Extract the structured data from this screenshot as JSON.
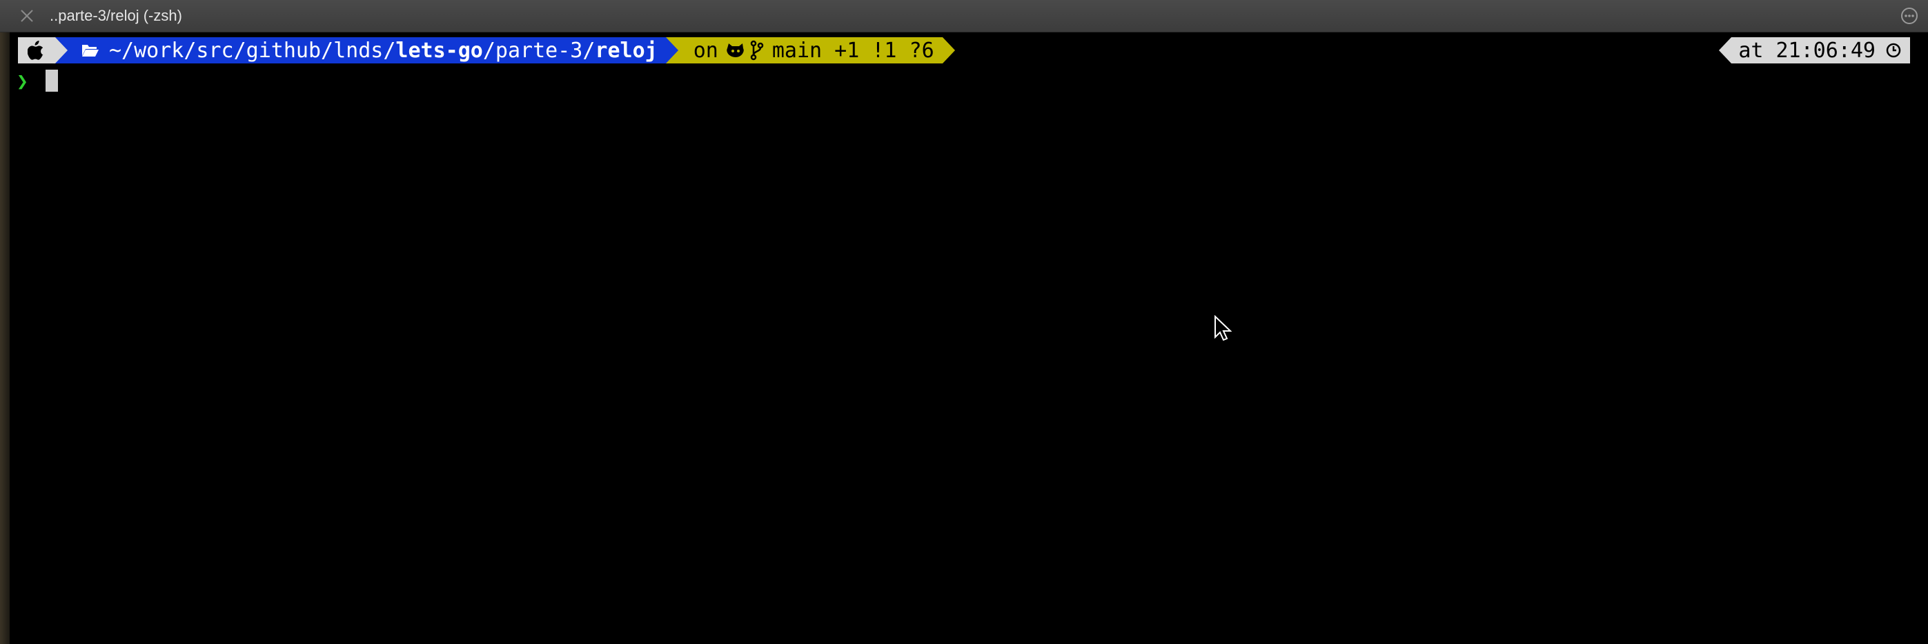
{
  "window": {
    "title": "..parte-3/reloj (-zsh)",
    "close_icon": "close-icon",
    "more_icon": "ellipsis-circle-icon"
  },
  "prompt": {
    "os_icon": "apple-icon",
    "dir_icon": "folder-open-icon",
    "path_prefix": "~/work/src/github/lnds/",
    "path_repo": "lets-go",
    "path_mid": "/parte-3/",
    "path_current": "reloj",
    "vcs_on": "on",
    "vcs_icon": "github-icon",
    "branch_icon": "git-branch-icon",
    "branch_status": "main +1 !1 ?6",
    "time_text": "at 21:06:49",
    "clock_icon": "clock-icon",
    "input_symbol": "❯"
  },
  "colors": {
    "dir_bg": "#1038d6",
    "vcs_bg": "#bfb800",
    "os_bg": "#d9d9d9",
    "prompt_symbol": "#2fcf2f"
  }
}
